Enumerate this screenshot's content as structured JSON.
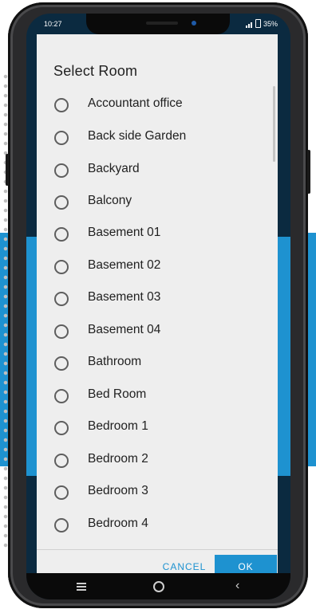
{
  "status_bar": {
    "time": "10:27",
    "battery": "35%"
  },
  "dialog": {
    "title": "Select Room",
    "items": [
      {
        "label": "Accountant office",
        "selected": false
      },
      {
        "label": "Back side Garden",
        "selected": false
      },
      {
        "label": "Backyard",
        "selected": false
      },
      {
        "label": "Balcony",
        "selected": false
      },
      {
        "label": "Basement 01",
        "selected": false
      },
      {
        "label": "Basement 02",
        "selected": false
      },
      {
        "label": "Basement 03",
        "selected": false
      },
      {
        "label": "Basement 04",
        "selected": false
      },
      {
        "label": "Bathroom",
        "selected": false
      },
      {
        "label": "Bed Room",
        "selected": false
      },
      {
        "label": "Bedroom 1",
        "selected": false
      },
      {
        "label": "Bedroom 2",
        "selected": false
      },
      {
        "label": "Bedroom 3",
        "selected": false
      },
      {
        "label": "Bedroom 4",
        "selected": false
      }
    ],
    "cancel_label": "CANCEL",
    "ok_label": "OK"
  },
  "colors": {
    "accent": "#1e92d0",
    "dialog_bg": "#eeeeee"
  },
  "nav_icons": [
    "menu-icon",
    "home-icon",
    "back-icon"
  ]
}
